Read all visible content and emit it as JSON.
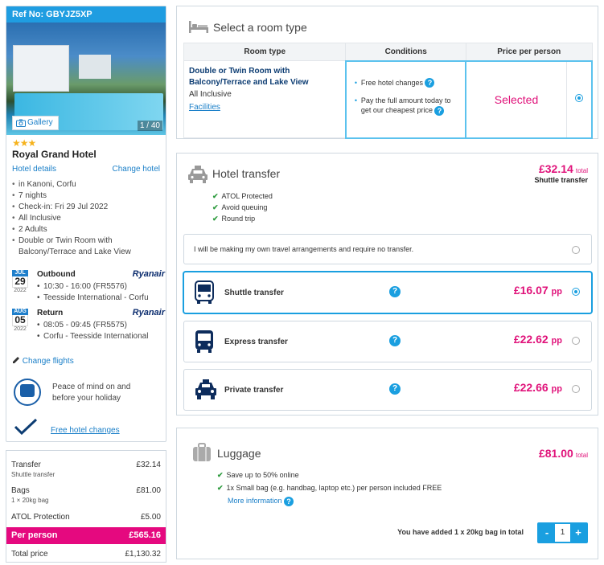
{
  "booking": {
    "ref": "Ref No: GBYJZ5XP"
  },
  "hotel": {
    "gallery_label": "Gallery",
    "photo_counter": "1 / 40",
    "stars": "★★★",
    "name": "Royal Grand Hotel",
    "details_link": "Hotel details",
    "change_link": "Change hotel",
    "facts": [
      "in Kanoni, Corfu",
      "7 nights",
      "Check-in: Fri 29 Jul 2022",
      "All Inclusive",
      "2 Adults",
      "Double or Twin Room with Balcony/Terrace and Lake View"
    ]
  },
  "flights": {
    "outbound": {
      "month": "JUL",
      "day": "29",
      "year": "2022",
      "label": "Outbound",
      "airline": "Ryanair",
      "time": "10:30 - 16:00 (FR5576)",
      "route": "Teesside International - Corfu"
    },
    "return": {
      "month": "AUG",
      "day": "05",
      "year": "2022",
      "label": "Return",
      "airline": "Ryanair",
      "time": "08:05 - 09:45 (FR5575)",
      "route": "Corfu - Teesside International"
    },
    "change_link": "Change flights"
  },
  "peace": {
    "text": "Peace of mind on and before your holiday"
  },
  "free_changes": {
    "label": "Free hotel changes"
  },
  "summary": {
    "transfer_label": "Transfer",
    "transfer_sub": "Shuttle transfer",
    "transfer_value": "£32.14",
    "bags_label": "Bags",
    "bags_sub": "1 × 20kg bag",
    "bags_value": "£81.00",
    "atol_label": "ATOL Protection",
    "atol_value": "£5.00",
    "per_person_label": "Per person",
    "per_person_value": "£565.16",
    "total_label": "Total price",
    "total_value": "£1,130.32"
  },
  "room": {
    "title": "Select a room type",
    "headers": [
      "Room type",
      "Conditions",
      "Price per person"
    ],
    "name": "Double or Twin Room with Balcony/Terrace and Lake View",
    "board": "All Inclusive",
    "facilities_link": "Facilities",
    "conditions": [
      "Free hotel changes",
      "Pay the full amount today to get our cheapest price"
    ],
    "price_status": "Selected"
  },
  "transfer": {
    "title": "Hotel transfer",
    "price": "£32.14",
    "price_suffix": "total",
    "price_type": "Shuttle transfer",
    "features": [
      "ATOL Protected",
      "Avoid queuing",
      "Round trip"
    ],
    "own_arrangements": "I will be making my own travel arrangements and require no transfer.",
    "options": [
      {
        "name": "Shuttle transfer",
        "price": "£16.07",
        "unit": "pp",
        "selected": true,
        "icon": "bus-icon"
      },
      {
        "name": "Express transfer",
        "price": "£22.62",
        "unit": "pp",
        "selected": false,
        "icon": "bus-icon"
      },
      {
        "name": "Private transfer",
        "price": "£22.66",
        "unit": "pp",
        "selected": false,
        "icon": "taxi-icon"
      }
    ]
  },
  "luggage": {
    "title": "Luggage",
    "price": "£81.00",
    "price_suffix": "total",
    "features": [
      "Save up to 50% online",
      "1x Small bag (e.g. handbag, laptop etc.) per person included FREE"
    ],
    "more_info": "More information",
    "added_text": "You have added 1 x 20kg bag in total",
    "minus": "-",
    "plus": "+",
    "count": "1"
  },
  "colors": {
    "accent": "#1a9fe0",
    "brand_pink": "#e5097f",
    "ref_bar": "#1f9de1",
    "tick": "#2e9b3f"
  }
}
